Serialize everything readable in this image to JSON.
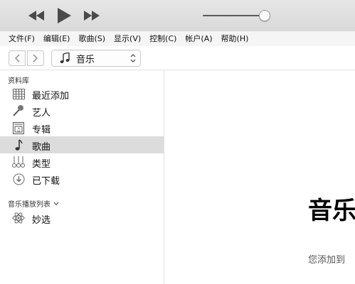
{
  "menu": [
    "文件(F)",
    "编辑(E)",
    "歌曲(S)",
    "显示(V)",
    "控制(C)",
    "帐户(A)",
    "帮助(H)"
  ],
  "toolbar": {
    "media_label": "音乐"
  },
  "sidebar": {
    "library_title": "资料库",
    "items": [
      {
        "label": "最近添加",
        "icon": "grid-icon"
      },
      {
        "label": "艺人",
        "icon": "microphone-icon"
      },
      {
        "label": "专辑",
        "icon": "album-icon"
      },
      {
        "label": "歌曲",
        "icon": "music-note-icon",
        "selected": true
      },
      {
        "label": "类型",
        "icon": "genre-icon"
      },
      {
        "label": "已下载",
        "icon": "download-icon"
      }
    ],
    "playlists_title": "音乐播放列表",
    "playlist_items": [
      {
        "label": "妙选",
        "icon": "atom-icon"
      }
    ]
  },
  "main": {
    "title": "音乐",
    "subtitle": "您添加到"
  },
  "volume": {
    "level": 0.92
  },
  "colors": {
    "selected_bg": "#dcdcdc",
    "topbar": "#dedede"
  }
}
